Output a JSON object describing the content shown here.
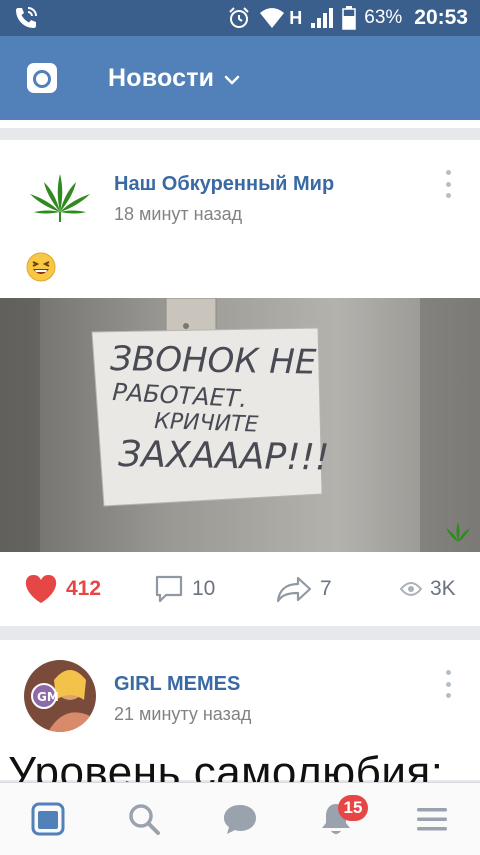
{
  "status_bar": {
    "network_label": "H",
    "battery": "63%",
    "time": "20:53",
    "icons": [
      "phone-signal-icon",
      "alarm-icon",
      "wifi-icon",
      "cell-signal-icon",
      "battery-icon"
    ]
  },
  "header": {
    "title": "Новости",
    "icons": [
      "camera-icon",
      "chevron-down-icon"
    ]
  },
  "posts": [
    {
      "author": "Наш Обкуренный Мир",
      "time": "18 минут назад",
      "emoji": "😆",
      "image_text": [
        "ЗВОНОК НЕ",
        "РАБОТАЕТ.",
        "КРИЧИТЕ",
        "ЗАХАААР!!!"
      ],
      "likes": "412",
      "comments": "10",
      "shares": "7",
      "views": "3K"
    },
    {
      "author": "GIRL MEMES",
      "time": "21 минуту назад",
      "text": "Уровень самолюбия:"
    }
  ],
  "bottom_nav": {
    "items": [
      "news-icon",
      "search-icon",
      "messages-icon",
      "notifications-icon",
      "menu-icon"
    ],
    "notifications_badge": "15"
  },
  "colors": {
    "status_bar": "#3b5f8c",
    "header": "#5181b8",
    "author": "#3a6aa3",
    "like": "#e64646",
    "badge": "#e64646",
    "nav_active": "#5181b8"
  }
}
